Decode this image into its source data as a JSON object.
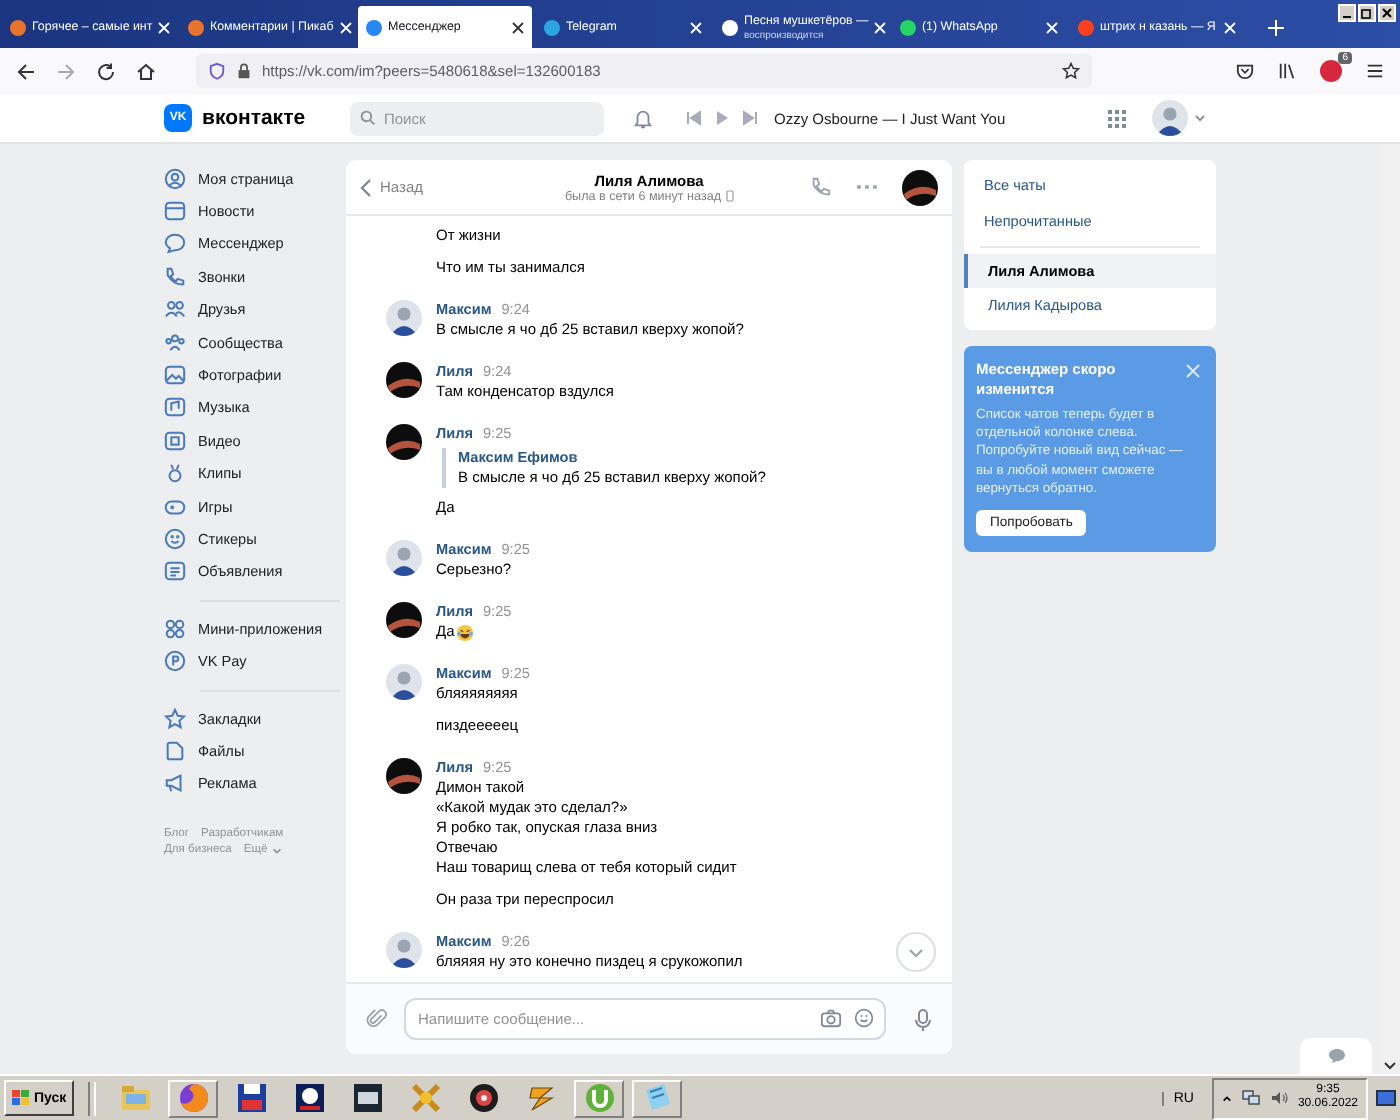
{
  "browser": {
    "tabs": [
      {
        "title": "Горячее – самые инт",
        "selected": false,
        "color": "#e8742c"
      },
      {
        "title": "Комментарии | Пикаб",
        "selected": false,
        "color": "#e8742c"
      },
      {
        "title": "Мессенджер",
        "selected": true,
        "color": "#2787f5"
      },
      {
        "title": "Telegram",
        "selected": false,
        "color": "#2ca5e0"
      },
      {
        "title": "Песня мушкетёров —",
        "subtitle": "воспроизводится",
        "selected": false,
        "color": "#ffffff"
      },
      {
        "title": "(1) WhatsApp",
        "selected": false,
        "color": "#25d366"
      },
      {
        "title": "штрих н казань — Я",
        "selected": false,
        "color": "#fc3f1d"
      }
    ],
    "url": "https://vk.com/im?peers=5480618&sel=132600183",
    "extension_badge": "6"
  },
  "header": {
    "logo_mark": "VK",
    "logo_text": "вконтакте",
    "search_placeholder": "Поиск",
    "now_playing": "Ozzy Osbourne — I Just Want You"
  },
  "sidebar": {
    "sections": [
      {
        "items": [
          "Моя страница",
          "Новости",
          "Мессенджер",
          "Звонки",
          "Друзья",
          "Сообщества",
          "Фотографии",
          "Музыка",
          "Видео",
          "Клипы",
          "Игры",
          "Стикеры",
          "Объявления"
        ]
      },
      {
        "items": [
          "Мини-приложения",
          "VK Pay"
        ]
      },
      {
        "items": [
          "Закладки",
          "Файлы",
          "Реклама"
        ]
      }
    ],
    "footer_links": [
      "Блог",
      "Разработчикам",
      "Для бизнеса",
      "Ещё"
    ]
  },
  "chat": {
    "back": "Назад",
    "name": "Лиля Алимова",
    "status": "была в сети 6 минут назад",
    "groups": [
      {
        "messages": [
          {
            "lines": [
              "От жизни"
            ]
          },
          {
            "lines": [
              "Что им ты занимался"
            ]
          }
        ]
      },
      {
        "author": "Максим",
        "time": "9:24",
        "kind": "man",
        "messages": [
          {
            "lines": [
              "В смысле я чо дб 25 вставил кверху жопой?"
            ]
          }
        ]
      },
      {
        "author": "Лиля",
        "time": "9:24",
        "kind": "dark",
        "messages": [
          {
            "lines": [
              "Там конденсатор вздулся"
            ]
          }
        ]
      },
      {
        "author": "Лиля",
        "time": "9:25",
        "kind": "dark",
        "messages": [
          {
            "reply": {
              "author": "Максим Ефимов",
              "text": "В смысле я чо дб 25 вставил кверху жопой?"
            },
            "lines": [
              "Да"
            ]
          }
        ]
      },
      {
        "author": "Максим",
        "time": "9:25",
        "kind": "man",
        "messages": [
          {
            "lines": [
              "Серьезно?"
            ]
          }
        ]
      },
      {
        "author": "Лиля",
        "time": "9:25",
        "kind": "dark",
        "messages": [
          {
            "lines": [
              "Да"
            ],
            "kind": "laughing_emoji"
          }
        ]
      },
      {
        "author": "Максим",
        "time": "9:25",
        "kind": "man",
        "messages": [
          {
            "lines": [
              "бляяяяяяяя"
            ]
          },
          {
            "lines": [
              "пиздееееец"
            ]
          }
        ]
      },
      {
        "author": "Лиля",
        "time": "9:25",
        "kind": "dark",
        "messages": [
          {
            "lines": [
              "Димон такой",
              "«Какой мудак это сделал?»",
              "Я робко так, опуская глаза вниз",
              "Отвечаю",
              "Наш товарищ слева от тебя который сидит"
            ]
          },
          {
            "lines": [
              "Он раза три переспросил"
            ]
          }
        ]
      },
      {
        "author": "Максим",
        "time": "9:26",
        "kind": "man",
        "messages": [
          {
            "lines": [
              "бляяяя ну это конечно пиздец я срукожопил"
            ]
          }
        ]
      }
    ],
    "composer_placeholder": "Напишите сообщение..."
  },
  "right_panel": {
    "folders": [
      "Все чаты",
      "Непрочитанные"
    ],
    "chats": [
      {
        "name": "Лиля Алимова",
        "selected": true
      },
      {
        "name": "Лилия Кадырова",
        "selected": false
      }
    ],
    "banner": {
      "title": "Мессенджер скоро изменится",
      "text": "Список чатов теперь будет в отдельной колонке слева. Попробуйте новый вид сейчас — вы в любой момент сможете вернуться обратно.",
      "button": "Попробовать"
    }
  },
  "taskbar": {
    "start": "Пуск",
    "language": "RU",
    "time": "9:35",
    "date": "30.06.2022"
  }
}
